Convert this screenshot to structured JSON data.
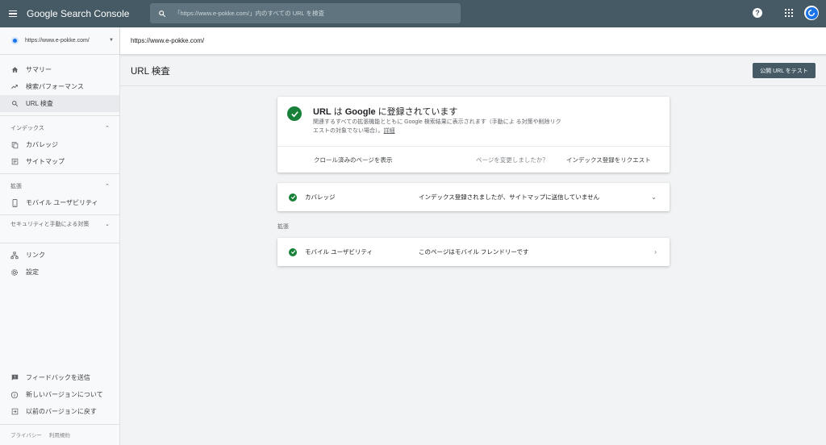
{
  "header": {
    "brand": "Google Search Console",
    "search_placeholder": "「https://www.e-pokke.com/」内のすべての URL を検査"
  },
  "sidebar": {
    "property": "https://www.e-pokke.com/",
    "nav": [
      {
        "label": "サマリー",
        "icon": "home-icon"
      },
      {
        "label": "検索パフォーマンス",
        "icon": "trending-up-icon"
      },
      {
        "label": "URL 検査",
        "icon": "search-icon"
      }
    ],
    "index_section": "インデックス",
    "index_items": [
      {
        "label": "カバレッジ",
        "icon": "coverage-icon"
      },
      {
        "label": "サイトマップ",
        "icon": "sitemap-icon"
      }
    ],
    "enhancements_section": "拡張",
    "enhancements_items": [
      {
        "label": "モバイル ユーザビリティ",
        "icon": "phone-icon"
      }
    ],
    "security_section": "セキュリティと手動による対策",
    "other_items": [
      {
        "label": "リンク",
        "icon": "links-icon"
      },
      {
        "label": "設定",
        "icon": "gear-icon"
      }
    ],
    "bottom_items": [
      {
        "label": "フィードバックを送信",
        "icon": "feedback-icon"
      },
      {
        "label": "新しいバージョンについて",
        "icon": "info-icon"
      },
      {
        "label": "以前のバージョンに戻す",
        "icon": "exit-icon"
      }
    ],
    "footer": {
      "privacy": "プライバシー",
      "terms": "利用規約"
    }
  },
  "main": {
    "url": "https://www.e-pokke.com/",
    "page_title": "URL 検査",
    "test_button": "公開 URL をテスト",
    "status": {
      "title_prefix": "URL",
      "title_mid": " は ",
      "title_google": "Google",
      "title_suffix": " に登録されています",
      "description": "関連するすべての拡張機能とともに Google 検索結果に表示されます（手動によ る対策や削除リクエストの対象でない場合）。",
      "details_link": "詳細",
      "crawled_link": "クロール済みのページを表示",
      "changed_question": "ページを変更しましたか？",
      "request_indexing": "インデックス登録をリクエスト"
    },
    "coverage": {
      "name": "カバレッジ",
      "value": "インデックス登録されましたが、サイトマップに送信していません"
    },
    "enhancements_label": "拡張",
    "mobile": {
      "name": "モバイル ユーザビリティ",
      "value": "このページはモバイル フレンドリーです"
    }
  },
  "colors": {
    "topbar": "#455a64",
    "success": "#188038",
    "accent": "#1a73e8"
  }
}
